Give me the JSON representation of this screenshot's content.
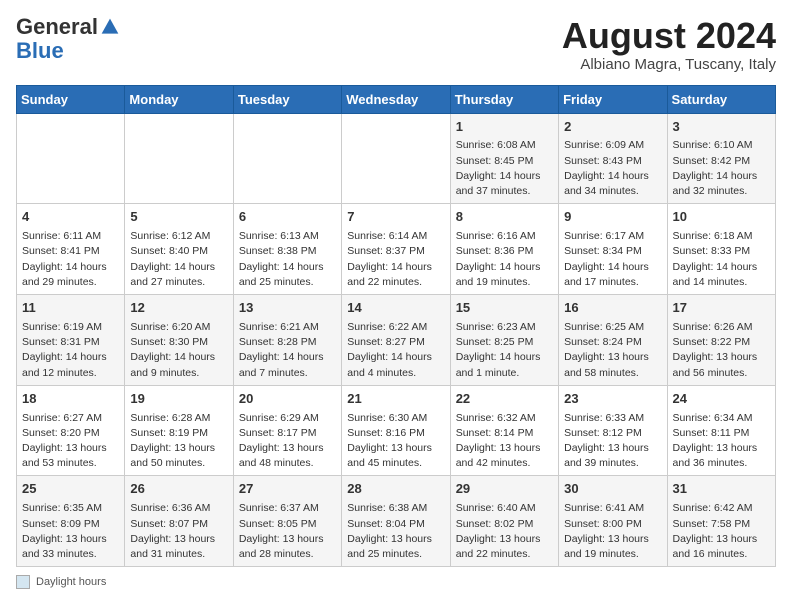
{
  "logo": {
    "general": "General",
    "blue": "Blue"
  },
  "title": {
    "month_year": "August 2024",
    "location": "Albiano Magra, Tuscany, Italy"
  },
  "weekdays": [
    "Sunday",
    "Monday",
    "Tuesday",
    "Wednesday",
    "Thursday",
    "Friday",
    "Saturday"
  ],
  "weeks": [
    [
      {
        "day": "",
        "info": ""
      },
      {
        "day": "",
        "info": ""
      },
      {
        "day": "",
        "info": ""
      },
      {
        "day": "",
        "info": ""
      },
      {
        "day": "1",
        "info": "Sunrise: 6:08 AM\nSunset: 8:45 PM\nDaylight: 14 hours and 37 minutes."
      },
      {
        "day": "2",
        "info": "Sunrise: 6:09 AM\nSunset: 8:43 PM\nDaylight: 14 hours and 34 minutes."
      },
      {
        "day": "3",
        "info": "Sunrise: 6:10 AM\nSunset: 8:42 PM\nDaylight: 14 hours and 32 minutes."
      }
    ],
    [
      {
        "day": "4",
        "info": "Sunrise: 6:11 AM\nSunset: 8:41 PM\nDaylight: 14 hours and 29 minutes."
      },
      {
        "day": "5",
        "info": "Sunrise: 6:12 AM\nSunset: 8:40 PM\nDaylight: 14 hours and 27 minutes."
      },
      {
        "day": "6",
        "info": "Sunrise: 6:13 AM\nSunset: 8:38 PM\nDaylight: 14 hours and 25 minutes."
      },
      {
        "day": "7",
        "info": "Sunrise: 6:14 AM\nSunset: 8:37 PM\nDaylight: 14 hours and 22 minutes."
      },
      {
        "day": "8",
        "info": "Sunrise: 6:16 AM\nSunset: 8:36 PM\nDaylight: 14 hours and 19 minutes."
      },
      {
        "day": "9",
        "info": "Sunrise: 6:17 AM\nSunset: 8:34 PM\nDaylight: 14 hours and 17 minutes."
      },
      {
        "day": "10",
        "info": "Sunrise: 6:18 AM\nSunset: 8:33 PM\nDaylight: 14 hours and 14 minutes."
      }
    ],
    [
      {
        "day": "11",
        "info": "Sunrise: 6:19 AM\nSunset: 8:31 PM\nDaylight: 14 hours and 12 minutes."
      },
      {
        "day": "12",
        "info": "Sunrise: 6:20 AM\nSunset: 8:30 PM\nDaylight: 14 hours and 9 minutes."
      },
      {
        "day": "13",
        "info": "Sunrise: 6:21 AM\nSunset: 8:28 PM\nDaylight: 14 hours and 7 minutes."
      },
      {
        "day": "14",
        "info": "Sunrise: 6:22 AM\nSunset: 8:27 PM\nDaylight: 14 hours and 4 minutes."
      },
      {
        "day": "15",
        "info": "Sunrise: 6:23 AM\nSunset: 8:25 PM\nDaylight: 14 hours and 1 minute."
      },
      {
        "day": "16",
        "info": "Sunrise: 6:25 AM\nSunset: 8:24 PM\nDaylight: 13 hours and 58 minutes."
      },
      {
        "day": "17",
        "info": "Sunrise: 6:26 AM\nSunset: 8:22 PM\nDaylight: 13 hours and 56 minutes."
      }
    ],
    [
      {
        "day": "18",
        "info": "Sunrise: 6:27 AM\nSunset: 8:20 PM\nDaylight: 13 hours and 53 minutes."
      },
      {
        "day": "19",
        "info": "Sunrise: 6:28 AM\nSunset: 8:19 PM\nDaylight: 13 hours and 50 minutes."
      },
      {
        "day": "20",
        "info": "Sunrise: 6:29 AM\nSunset: 8:17 PM\nDaylight: 13 hours and 48 minutes."
      },
      {
        "day": "21",
        "info": "Sunrise: 6:30 AM\nSunset: 8:16 PM\nDaylight: 13 hours and 45 minutes."
      },
      {
        "day": "22",
        "info": "Sunrise: 6:32 AM\nSunset: 8:14 PM\nDaylight: 13 hours and 42 minutes."
      },
      {
        "day": "23",
        "info": "Sunrise: 6:33 AM\nSunset: 8:12 PM\nDaylight: 13 hours and 39 minutes."
      },
      {
        "day": "24",
        "info": "Sunrise: 6:34 AM\nSunset: 8:11 PM\nDaylight: 13 hours and 36 minutes."
      }
    ],
    [
      {
        "day": "25",
        "info": "Sunrise: 6:35 AM\nSunset: 8:09 PM\nDaylight: 13 hours and 33 minutes."
      },
      {
        "day": "26",
        "info": "Sunrise: 6:36 AM\nSunset: 8:07 PM\nDaylight: 13 hours and 31 minutes."
      },
      {
        "day": "27",
        "info": "Sunrise: 6:37 AM\nSunset: 8:05 PM\nDaylight: 13 hours and 28 minutes."
      },
      {
        "day": "28",
        "info": "Sunrise: 6:38 AM\nSunset: 8:04 PM\nDaylight: 13 hours and 25 minutes."
      },
      {
        "day": "29",
        "info": "Sunrise: 6:40 AM\nSunset: 8:02 PM\nDaylight: 13 hours and 22 minutes."
      },
      {
        "day": "30",
        "info": "Sunrise: 6:41 AM\nSunset: 8:00 PM\nDaylight: 13 hours and 19 minutes."
      },
      {
        "day": "31",
        "info": "Sunrise: 6:42 AM\nSunset: 7:58 PM\nDaylight: 13 hours and 16 minutes."
      }
    ]
  ],
  "footer": {
    "box_label": "Daylight hours"
  }
}
